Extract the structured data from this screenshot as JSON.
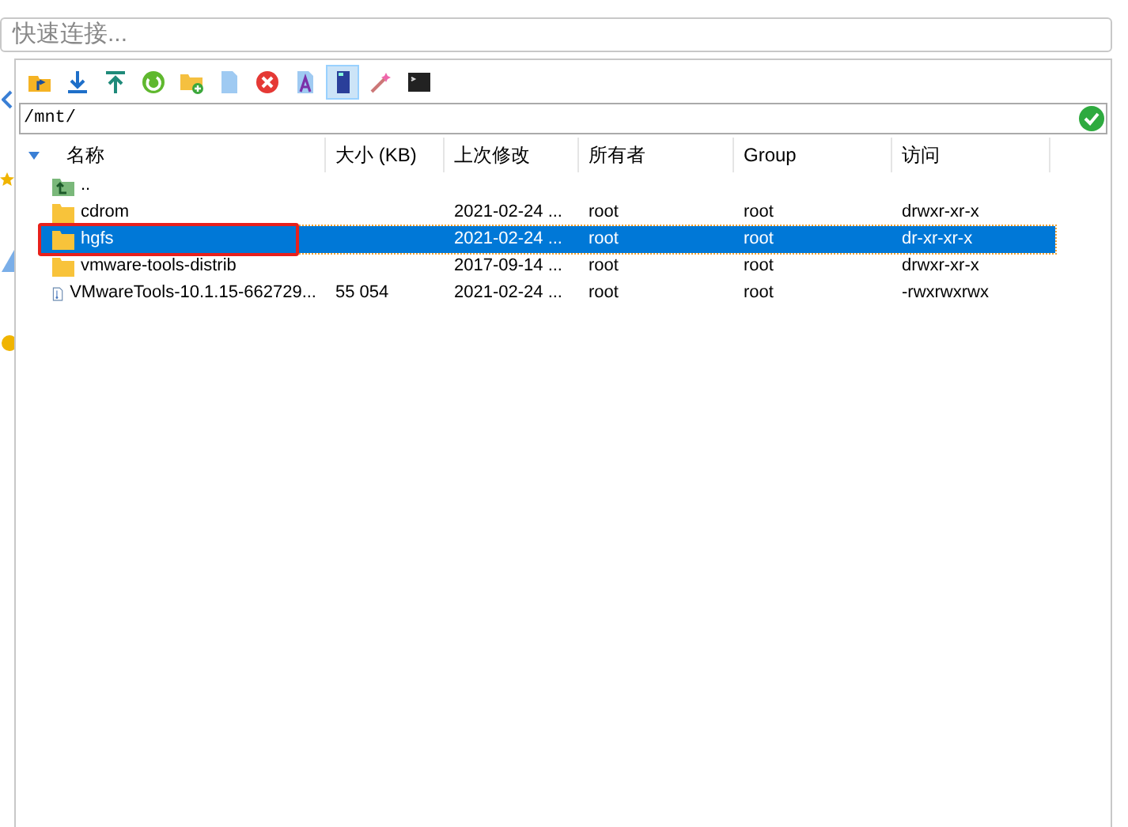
{
  "quick_connect": {
    "placeholder": "快速连接..."
  },
  "toolbar": [
    {
      "kind": "up-folder",
      "selected": false
    },
    {
      "kind": "download",
      "selected": false
    },
    {
      "kind": "upload",
      "selected": false
    },
    {
      "kind": "refresh",
      "selected": false
    },
    {
      "kind": "new-folder",
      "selected": false
    },
    {
      "kind": "new-file",
      "selected": false
    },
    {
      "kind": "delete",
      "selected": false
    },
    {
      "kind": "rename",
      "selected": false
    },
    {
      "kind": "panel",
      "selected": true
    },
    {
      "kind": "wand",
      "selected": false
    },
    {
      "kind": "terminal",
      "selected": false
    }
  ],
  "path": {
    "value": "/mnt/"
  },
  "table": {
    "columns": [
      "名称",
      "大小 (KB)",
      "上次修改",
      "所有者",
      "Group",
      "访问"
    ],
    "rows": [
      {
        "kind": "parent",
        "name": "..",
        "size": "",
        "modified": "",
        "owner": "",
        "group": "",
        "access": "",
        "selected": false
      },
      {
        "kind": "folder",
        "name": "cdrom",
        "size": "",
        "modified": "2021-02-24 ...",
        "owner": "root",
        "group": "root",
        "access": "drwxr-xr-x",
        "selected": false
      },
      {
        "kind": "folder",
        "name": "hgfs",
        "size": "",
        "modified": "2021-02-24 ...",
        "owner": "root",
        "group": "root",
        "access": "dr-xr-xr-x",
        "selected": true,
        "highlighted": true
      },
      {
        "kind": "folder",
        "name": "vmware-tools-distrib",
        "size": "",
        "modified": "2017-09-14 ...",
        "owner": "root",
        "group": "root",
        "access": "drwxr-xr-x",
        "selected": false
      },
      {
        "kind": "file",
        "name": "VMwareTools-10.1.15-662729...",
        "size": "55 054",
        "modified": "2021-02-24 ...",
        "owner": "root",
        "group": "root",
        "access": "-rwxrwxrwx",
        "selected": false
      }
    ]
  }
}
